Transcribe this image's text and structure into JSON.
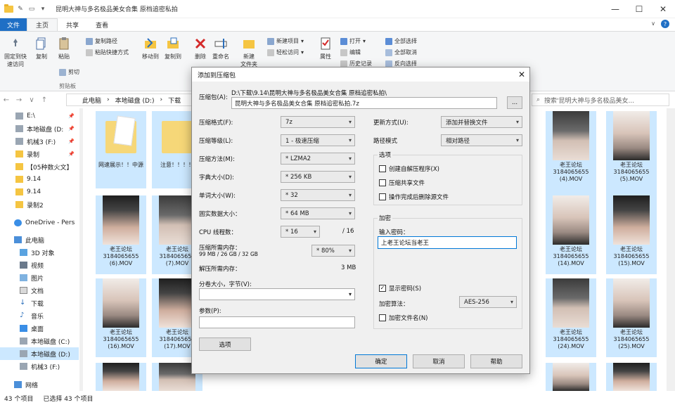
{
  "window": {
    "title": "昆明大神与多名极品美女合集 原档追密私拍"
  },
  "ribbon": {
    "tabs": [
      "文件",
      "主页",
      "共享",
      "查看"
    ],
    "buttons": {
      "pin_quick": "固定到快\n速访问",
      "copy": "复制",
      "paste": "粘贴",
      "copy_path": "复制路径",
      "paste_shortcut": "粘贴快捷方式",
      "cut": "剪切",
      "move_to": "移动到",
      "copy_to": "复制到",
      "delete": "删除",
      "rename": "重命名",
      "new_folder": "新建\n文件夹",
      "new_item": "新建项目",
      "easy_access": "轻松访问",
      "properties": "属性",
      "open": "打开",
      "edit": "编辑",
      "history": "历史记录",
      "select_all": "全部选择",
      "select_none": "全部取消",
      "invert": "反向选择"
    },
    "groups": {
      "clipboard": "剪贴板"
    }
  },
  "address": {
    "crumbs": [
      "此电脑",
      "本地磁盘 (D:)",
      "下载"
    ],
    "search_placeholder": "搜索'昆明大神与多名极品美女..."
  },
  "sidebar": {
    "items": [
      "E:\\",
      "本地磁盘 (D:",
      "机械3 (F:)",
      "录制",
      "【05种数火文】",
      "9.14",
      "9.14",
      "录制2",
      "OneDrive - Pers",
      "此电脑",
      "3D 对象",
      "视频",
      "图片",
      "文档",
      "下载",
      "音乐",
      "桌面",
      "本地磁盘 (C:)",
      "本地磁盘 (D:)",
      "机械3 (F:)",
      "网络"
    ]
  },
  "files": {
    "folder1": "网速展示！！中源",
    "folder2": "注意！！！！",
    "row1_col8": "老王论坛\n3184065655\n(4).MOV",
    "row1_col9": "老王论坛\n3184065655\n(5).MOV",
    "row2_col1": "老王论坛\n3184065655\n(6).MOV",
    "row2_col2": "老王论坛\n3184065655\n(7).MOV",
    "row2_col8": "老王论坛\n3184065655\n(14).MOV",
    "row2_col9": "老王论坛\n3184065655\n(15).MOV",
    "row3_col1": "老王论坛\n3184065655\n(16).MOV",
    "row3_col2": "老王论坛\n3184065655\n(17).MOV",
    "row3_col8": "老王论坛\n3184065655\n(24).MOV",
    "row3_col9": "老王论坛\n3184065655\n(25).MOV"
  },
  "status": {
    "count": "43 个项目",
    "selected": "已选择 43 个项目"
  },
  "dialog": {
    "title": "添加到压缩包",
    "archive_label": "压缩包(A):",
    "archive_path_hint": "D:\\下载\\9.14\\昆明大神与多名极品美女合集 原档追密私拍\\",
    "archive_name": "昆明大神与多名极品美女合集 原档追密私拍.7z",
    "browse": "...",
    "format_label": "压缩格式(F):",
    "format": "7z",
    "level_label": "压缩等级(L):",
    "level": "1 - 极速压缩",
    "method_label": "压缩方法(M):",
    "method": "* LZMA2",
    "dict_label": "字典大小(D):",
    "dict": "* 256 KB",
    "word_label": "单词大小(W):",
    "word": "* 32",
    "solid_label": "固实数据大小：",
    "solid": "* 64 MB",
    "cpu_label": "CPU 线程数：",
    "cpu": "* 16",
    "cpu_max": "/ 16",
    "mem_label": "压缩所需内存：",
    "mem_detail": "99 MB / 26 GB / 32 GB",
    "mem_pct": "* 80%",
    "decomp_label": "解压所需内存：",
    "decomp_value": "3 MB",
    "split_label": "分卷大小，字节(V):",
    "params_label": "参数(P):",
    "options_btn": "选项",
    "update_label": "更新方式(U):",
    "update": "添加并替换文件",
    "path_label": "路径模式",
    "path": "相对路径",
    "options_group": "选项",
    "opt1": "创建自解压程序(X)",
    "opt2": "压缩共享文件",
    "opt3": "操作完成后删除源文件",
    "enc_group": "加密",
    "pwd_label": "输入密码：",
    "password": "上老王论坛当老王",
    "show_pwd": "显示密码(S)",
    "enc_method_label": "加密算法：",
    "enc_method": "AES-256",
    "enc_names": "加密文件名(N)",
    "ok": "确定",
    "cancel": "取消",
    "help": "帮助"
  }
}
